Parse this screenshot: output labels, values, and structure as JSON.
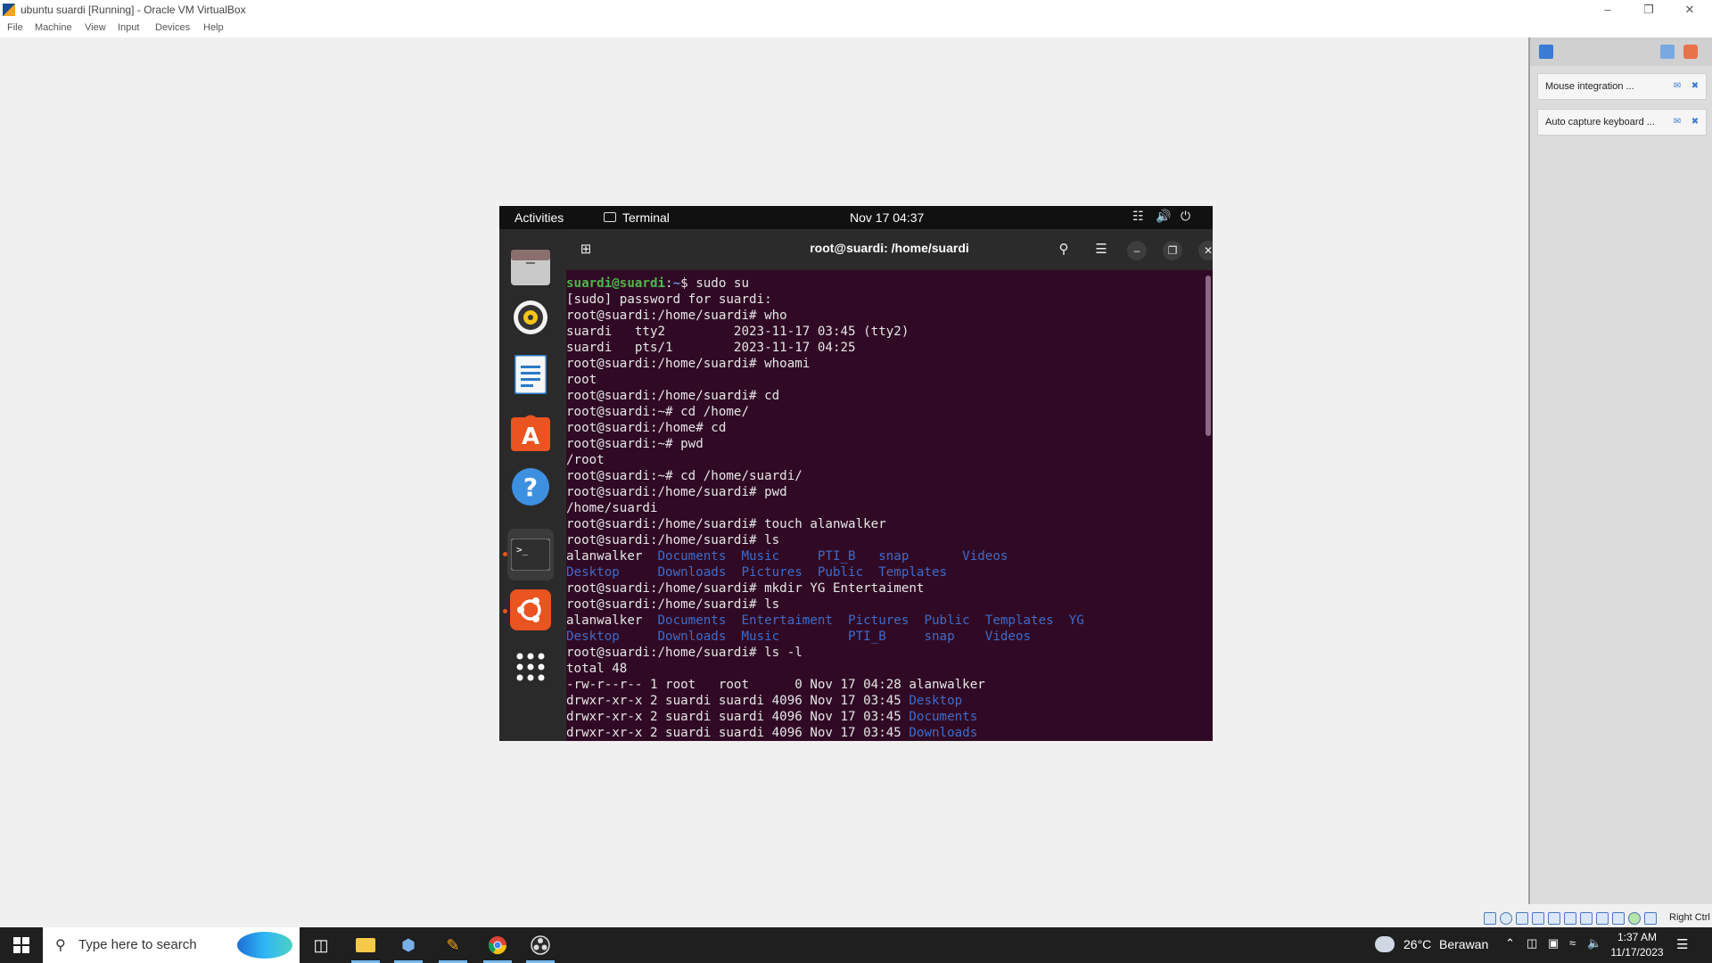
{
  "window": {
    "title": "ubuntu suardi [Running] - Oracle VM VirtualBox",
    "menu": [
      "File",
      "Machine",
      "View",
      "Input",
      "Devices",
      "Help"
    ]
  },
  "ubuntu_topbar": {
    "activities": "Activities",
    "app_name": "Terminal",
    "clock": "Nov 17  04:37"
  },
  "terminal": {
    "title": "root@suardi: /home/suardi",
    "lines": [
      [
        {
          "t": "suardi@suardi",
          "c": "user"
        },
        {
          "t": ":",
          "c": ""
        },
        {
          "t": "~",
          "c": "path"
        },
        {
          "t": "$ sudo su",
          "c": ""
        }
      ],
      [
        {
          "t": "[sudo] password for suardi:",
          "c": ""
        }
      ],
      [
        {
          "t": "root@suardi:/home/suardi# who",
          "c": ""
        }
      ],
      [
        {
          "t": "suardi   tty2         2023-11-17 03:45 (tty2)",
          "c": ""
        }
      ],
      [
        {
          "t": "suardi   pts/1        2023-11-17 04:25",
          "c": ""
        }
      ],
      [
        {
          "t": "root@suardi:/home/suardi# whoami",
          "c": ""
        }
      ],
      [
        {
          "t": "root",
          "c": ""
        }
      ],
      [
        {
          "t": "root@suardi:/home/suardi# cd",
          "c": ""
        }
      ],
      [
        {
          "t": "root@suardi:~# cd /home/",
          "c": ""
        }
      ],
      [
        {
          "t": "root@suardi:/home# cd",
          "c": ""
        }
      ],
      [
        {
          "t": "root@suardi:~# pwd",
          "c": ""
        }
      ],
      [
        {
          "t": "/root",
          "c": ""
        }
      ],
      [
        {
          "t": "root@suardi:~# cd /home/suardi/",
          "c": ""
        }
      ],
      [
        {
          "t": "root@suardi:/home/suardi# pwd",
          "c": ""
        }
      ],
      [
        {
          "t": "/home/suardi",
          "c": ""
        }
      ],
      [
        {
          "t": "root@suardi:/home/suardi# touch alanwalker",
          "c": ""
        }
      ],
      [
        {
          "t": "root@suardi:/home/suardi# ls",
          "c": ""
        }
      ],
      [
        {
          "t": "alanwalker  ",
          "c": ""
        },
        {
          "t": "Documents  Music     PTI_B   snap       Videos",
          "c": "dir"
        }
      ],
      [
        {
          "t": "Desktop     Downloads  Pictures  Public  Templates",
          "c": "dir"
        }
      ],
      [
        {
          "t": "root@suardi:/home/suardi# mkdir YG Entertaiment",
          "c": ""
        }
      ],
      [
        {
          "t": "root@suardi:/home/suardi# ls",
          "c": ""
        }
      ],
      [
        {
          "t": "alanwalker  ",
          "c": ""
        },
        {
          "t": "Documents  Entertaiment  Pictures  Public  Templates  YG",
          "c": "dir"
        }
      ],
      [
        {
          "t": "Desktop     Downloads  Music         PTI_B     snap    Videos",
          "c": "dir"
        }
      ],
      [
        {
          "t": "root@suardi:/home/suardi# ls -l",
          "c": ""
        }
      ],
      [
        {
          "t": "total 48",
          "c": ""
        }
      ],
      [
        {
          "t": "-rw-r--r-- 1 root   root      0 Nov 17 04:28 alanwalker",
          "c": ""
        }
      ],
      [
        {
          "t": "drwxr-xr-x 2 suardi suardi 4096 Nov 17 03:45 ",
          "c": ""
        },
        {
          "t": "Desktop",
          "c": "dir"
        }
      ],
      [
        {
          "t": "drwxr-xr-x 2 suardi suardi 4096 Nov 17 03:45 ",
          "c": ""
        },
        {
          "t": "Documents",
          "c": "dir"
        }
      ],
      [
        {
          "t": "drwxr-xr-x 2 suardi suardi 4096 Nov 17 03:45 ",
          "c": ""
        },
        {
          "t": "Downloads",
          "c": "dir"
        }
      ]
    ]
  },
  "vb_panel": {
    "notices": [
      "Mouse integration ...",
      "Auto capture keyboard ..."
    ]
  },
  "vb_status": {
    "host_key": "Right Ctrl"
  },
  "taskbar": {
    "search_placeholder": "Type here to search",
    "weather_temp": "26°C",
    "weather_text": "Berawan",
    "time": "1:37 AM",
    "date": "11/17/2023"
  },
  "colors": {
    "terminal_bg": "#300a24",
    "prompt_user": "#4eb74e",
    "prompt_path": "#6a8fe6",
    "directory": "#3f6bc9",
    "ubuntu_orange": "#e95420"
  }
}
